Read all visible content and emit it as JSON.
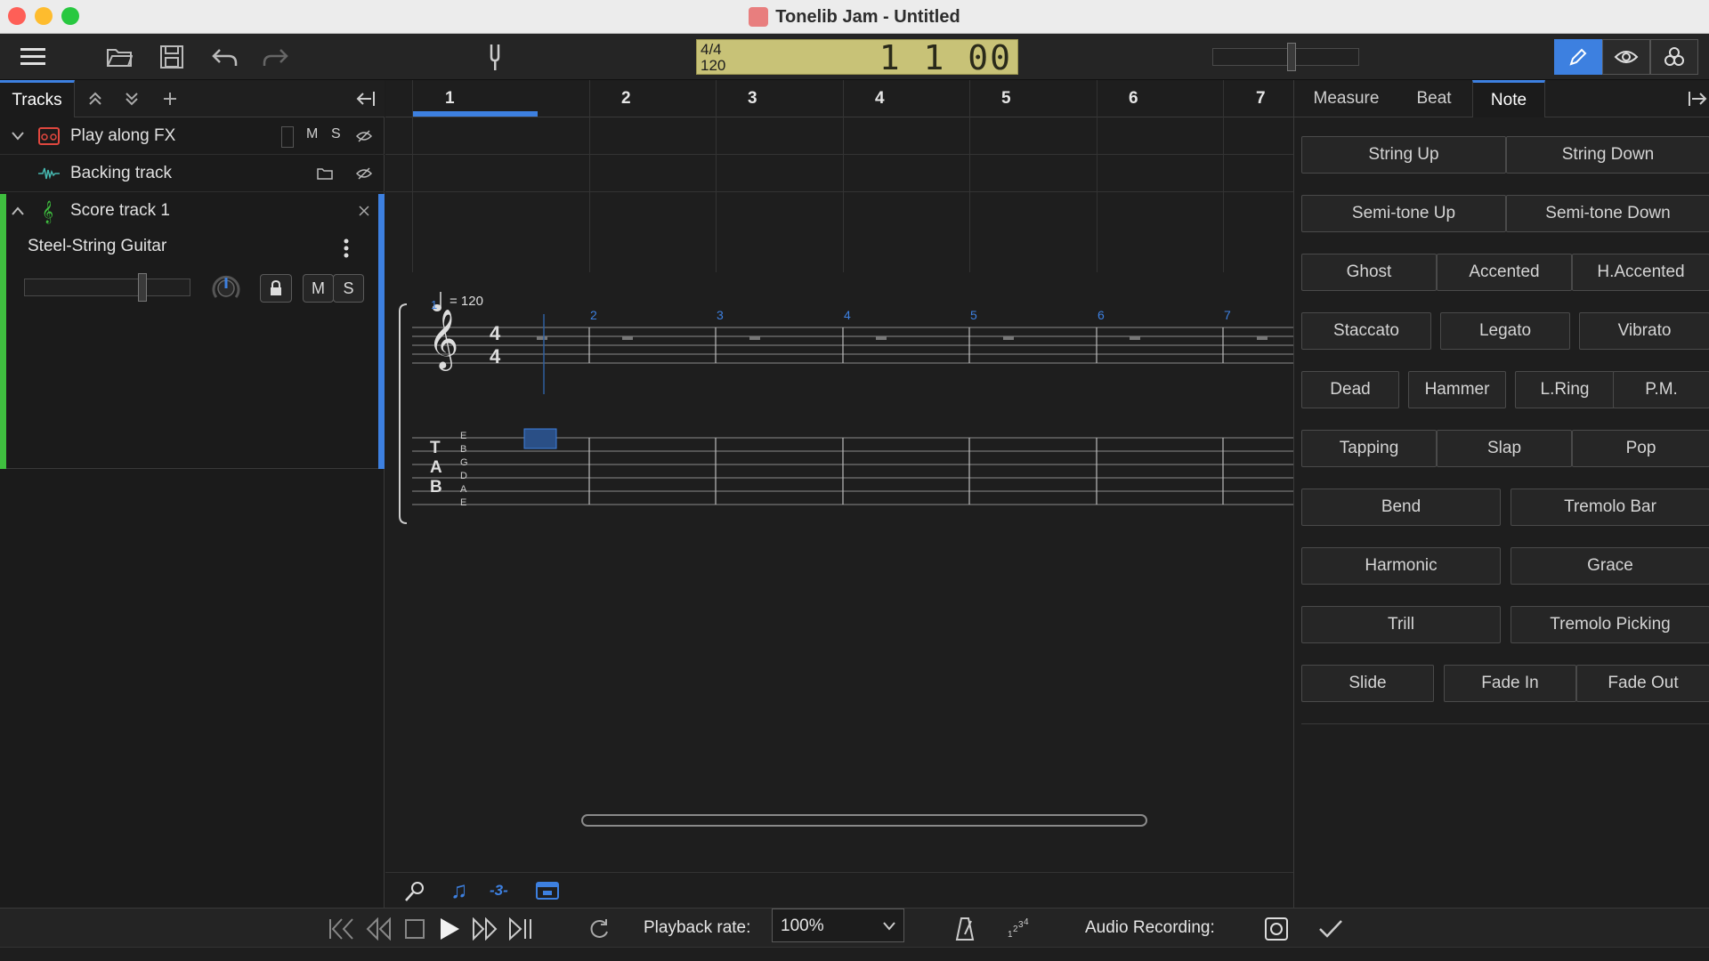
{
  "window": {
    "title": "Tonelib Jam - Untitled"
  },
  "toolbar": {
    "lcd": {
      "time_signature": "4/4",
      "tempo": "120",
      "position": "1 1 00"
    },
    "icons": [
      "menu-icon",
      "open-folder-icon",
      "save-icon",
      "undo-icon",
      "redo-icon",
      "tuning-fork-icon",
      "pencil-icon",
      "eye-icon",
      "shapes-icon"
    ]
  },
  "tracks": {
    "tab_label": "Tracks",
    "rows": [
      {
        "label": "Play along FX",
        "mute": "M",
        "solo": "S"
      },
      {
        "label": "Backing track"
      }
    ],
    "score_track": {
      "label": "Score track 1",
      "instrument": "Steel-String Guitar",
      "mute": "M",
      "solo": "S",
      "volume": 0.74
    }
  },
  "score": {
    "measures": [
      "1",
      "2",
      "3",
      "4",
      "5",
      "6",
      "7"
    ],
    "tempo_mark": "= 120",
    "time_sig_top": "4",
    "time_sig_bottom": "4",
    "tab_letters": [
      "T",
      "A",
      "B"
    ],
    "strings": [
      "E",
      "B",
      "G",
      "D",
      "A",
      "E"
    ],
    "triplet_label": "-3-"
  },
  "properties": {
    "tabs": [
      "Measure",
      "Beat",
      "Note"
    ],
    "active_tab": "Note",
    "buttons": {
      "string_up": "String Up",
      "string_down": "String Down",
      "semitone_up": "Semi-tone Up",
      "semitone_down": "Semi-tone Down",
      "ghost": "Ghost",
      "accented": "Accented",
      "h_accented": "H.Accented",
      "staccato": "Staccato",
      "legato": "Legato",
      "vibrato": "Vibrato",
      "dead": "Dead",
      "hammer": "Hammer",
      "l_ring": "L.Ring",
      "pm": "P.M.",
      "tapping": "Tapping",
      "slap": "Slap",
      "pop": "Pop",
      "bend": "Bend",
      "tremolo_bar": "Tremolo Bar",
      "harmonic": "Harmonic",
      "grace": "Grace",
      "trill": "Trill",
      "tremolo_picking": "Tremolo Picking",
      "slide": "Slide",
      "fade_in": "Fade In",
      "fade_out": "Fade Out"
    }
  },
  "transport": {
    "playback_rate_label": "Playback rate:",
    "playback_rate_value": "100%",
    "audio_recording_label": "Audio Recording:"
  }
}
